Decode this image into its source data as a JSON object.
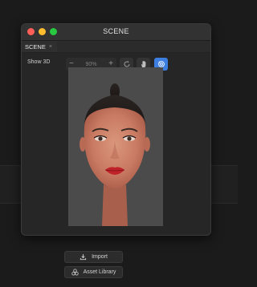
{
  "window": {
    "title": "SCENE",
    "tab": {
      "label": "SCENE",
      "close_glyph": "×"
    }
  },
  "toolbar": {
    "show3d_label": "Show 3D",
    "zoom": {
      "minus": "−",
      "value": "90%",
      "plus": "+"
    },
    "tools": [
      "refresh-icon",
      "hand-icon",
      "rotate-view-icon"
    ],
    "active_tool": "rotate-view-icon",
    "accent_color": "#3d7fe0"
  },
  "dock": {
    "import_label": "Import",
    "library_label": "Asset Library"
  }
}
